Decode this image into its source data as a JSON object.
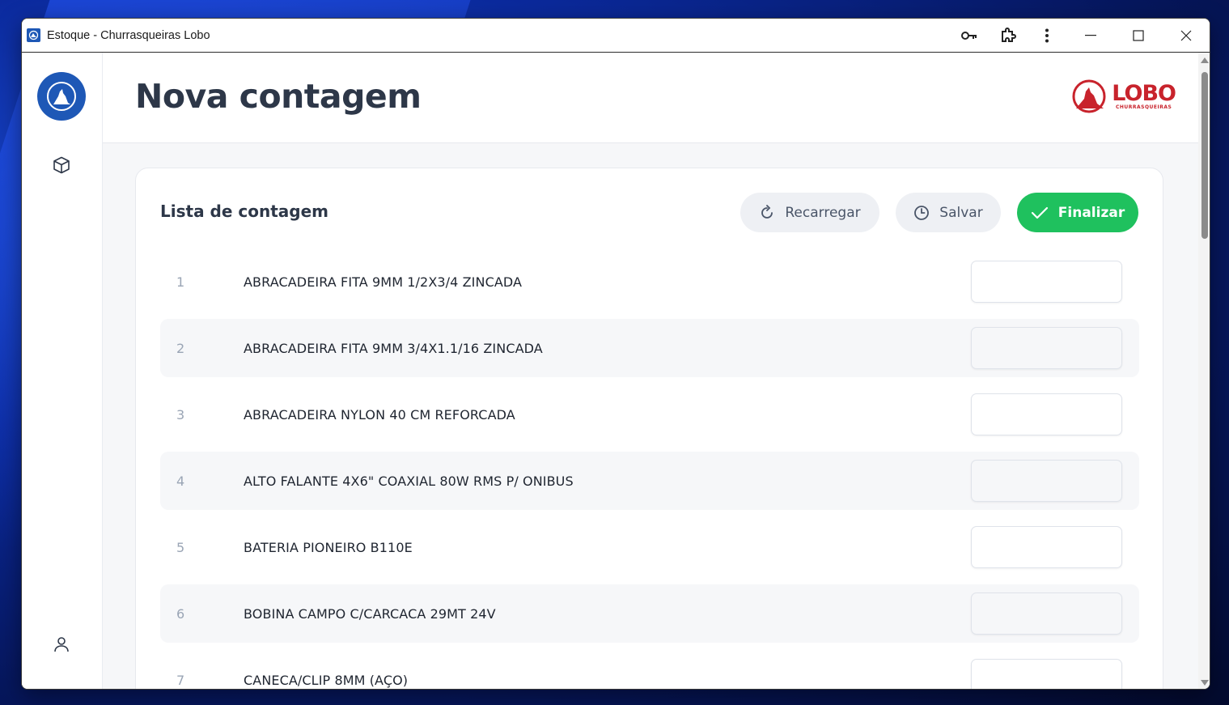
{
  "window": {
    "title": "Estoque - Churrasqueiras Lobo"
  },
  "titlebar_icons": [
    "key-icon",
    "extension-icon",
    "more-vert-icon",
    "minimize-icon",
    "maximize-icon",
    "close-icon"
  ],
  "sidebar": {
    "items": [
      {
        "icon": "cube-icon"
      },
      {
        "icon": "user-icon"
      }
    ]
  },
  "header": {
    "title": "Nova contagem",
    "brand_name": "LOBO",
    "brand_sub": "CHURRASQUEIRAS"
  },
  "card": {
    "title": "Lista de contagem",
    "buttons": {
      "reload": "Recarregar",
      "save": "Salvar",
      "finish": "Finalizar"
    }
  },
  "items": [
    {
      "num": "1",
      "name": "ABRACADEIRA FITA 9MM 1/2X3/4 ZINCADA",
      "value": ""
    },
    {
      "num": "2",
      "name": "ABRACADEIRA FITA 9MM 3/4X1.1/16 ZINCADA",
      "value": ""
    },
    {
      "num": "3",
      "name": "ABRACADEIRA NYLON 40 CM REFORCADA",
      "value": ""
    },
    {
      "num": "4",
      "name": "ALTO FALANTE 4X6\" COAXIAL 80W RMS P/ ONIBUS",
      "value": ""
    },
    {
      "num": "5",
      "name": "BATERIA PIONEIRO B110E",
      "value": ""
    },
    {
      "num": "6",
      "name": "BOBINA CAMPO C/CARCACA 29MT 24V",
      "value": ""
    },
    {
      "num": "7",
      "name": "CANECA/CLIP 8MM (AÇO)",
      "value": ""
    }
  ],
  "colors": {
    "accent": "#1e58b6",
    "success": "#1fc15e",
    "brand_red": "#c8232c",
    "title": "#2d3748"
  }
}
